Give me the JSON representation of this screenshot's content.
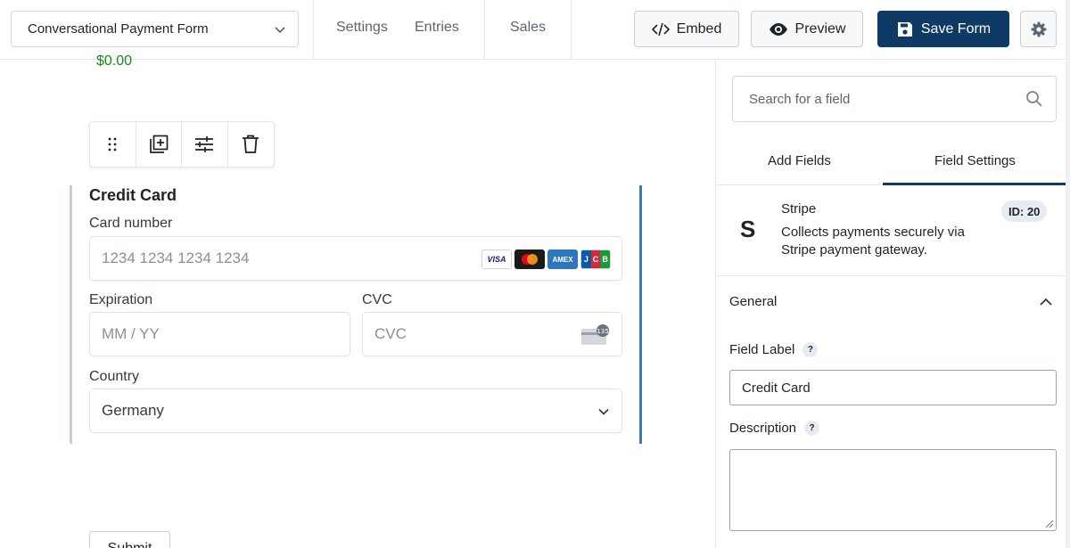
{
  "header": {
    "form_name": "Conversational Payment Form",
    "tabs": [
      {
        "label": "Settings"
      },
      {
        "label": "Entries"
      },
      {
        "label": "Sales"
      }
    ],
    "embed_label": "Embed",
    "preview_label": "Preview",
    "save_label": "Save Form",
    "save_color": "#0f3a66"
  },
  "canvas": {
    "price": "$0.00",
    "field_title": "Credit Card",
    "card_number_label": "Card number",
    "card_number_placeholder": "1234 1234 1234 1234",
    "card_brands": [
      "VISA",
      "AMEX",
      "J",
      "C",
      "B"
    ],
    "expiration_label": "Expiration",
    "expiration_placeholder": "MM / YY",
    "cvc_label": "CVC",
    "cvc_placeholder": "CVC",
    "cvc_icon_text": "135",
    "country_label": "Country",
    "country_value": "Germany",
    "submit_label": "Submit"
  },
  "panel": {
    "search_placeholder": "Search for a field",
    "tabs": [
      {
        "label": "Add Fields"
      },
      {
        "label": "Field Settings"
      }
    ],
    "active_tab": "Field Settings",
    "field_icon": "S",
    "field_name": "Stripe",
    "field_description": "Collects payments securely via Stripe payment gateway.",
    "field_id": "ID: 20",
    "section_title": "General",
    "field_label_caption": "Field Label",
    "field_label_value": "Credit Card",
    "description_caption": "Description",
    "help_glyph": "?",
    "description_value": ""
  }
}
